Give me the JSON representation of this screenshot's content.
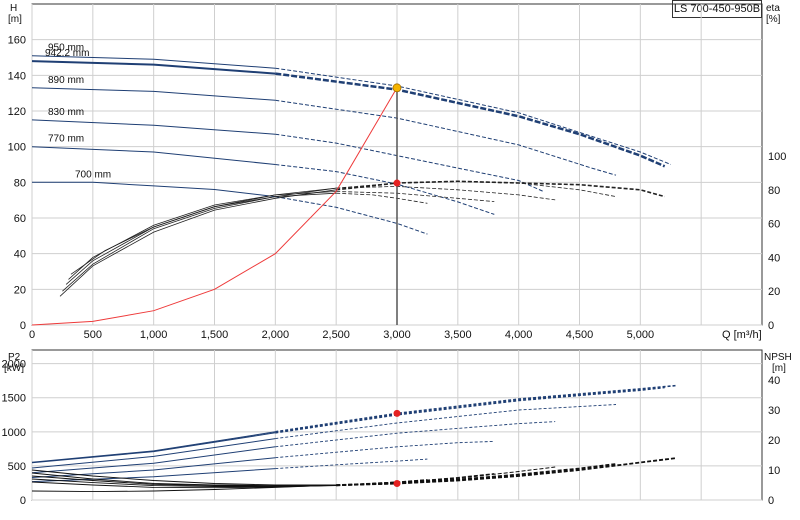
{
  "model_label": "LS 700-450-950B",
  "chart_data": [
    {
      "type": "line",
      "title": "",
      "y_axis_title": "H",
      "y_axis_unit": "[m]",
      "y2_axis_title": "eta",
      "y2_axis_unit": "[%]",
      "x_axis_unit_label": "Q [m³/h]",
      "xlim": [
        0,
        6000
      ],
      "ylim": [
        0,
        180
      ],
      "y2lim": [
        0,
        100
      ],
      "x_ticks": [
        0,
        500,
        1000,
        1500,
        2000,
        2500,
        3000,
        3500,
        4000,
        4500,
        5000
      ],
      "x_tick_labels": [
        "0",
        "500",
        "1,000",
        "1,500",
        "2,000",
        "2,500",
        "3,000",
        "3,500",
        "4,000",
        "4,500",
        "5,000"
      ],
      "y_ticks": [
        0,
        20,
        40,
        60,
        80,
        100,
        120,
        140,
        160
      ],
      "y2_ticks": [
        0,
        20,
        40,
        60,
        80,
        100
      ],
      "grid": true,
      "head_curves": [
        {
          "label": "950 mm",
          "points": [
            [
              0,
              151
            ],
            [
              1000,
              149
            ],
            [
              2000,
              144
            ],
            [
              3000,
              134
            ],
            [
              4000,
              119
            ],
            [
              4500,
              108
            ],
            [
              5000,
              97
            ],
            [
              5250,
              90
            ]
          ]
        },
        {
          "label": "942.2 mm",
          "points": [
            [
              0,
              148
            ],
            [
              1000,
              146
            ],
            [
              2000,
              141
            ],
            [
              3000,
              132
            ],
            [
              4000,
              117
            ],
            [
              4500,
              107
            ],
            [
              5000,
              95
            ],
            [
              5200,
              89
            ]
          ]
        },
        {
          "label": "890 mm",
          "points": [
            [
              0,
              133
            ],
            [
              1000,
              131
            ],
            [
              2000,
              126
            ],
            [
              3000,
              116
            ],
            [
              4000,
              101
            ],
            [
              4600,
              88
            ],
            [
              4800,
              84
            ]
          ]
        },
        {
          "label": "830 mm",
          "points": [
            [
              0,
              115
            ],
            [
              1000,
              112
            ],
            [
              2000,
              107
            ],
            [
              2500,
              102
            ],
            [
              3000,
              95
            ],
            [
              3500,
              88
            ],
            [
              4000,
              81
            ],
            [
              4200,
              75
            ]
          ]
        },
        {
          "label": "770 mm",
          "points": [
            [
              0,
              100
            ],
            [
              1000,
              97
            ],
            [
              2000,
              90
            ],
            [
              2500,
              86
            ],
            [
              3000,
              79
            ],
            [
              3500,
              69
            ],
            [
              3800,
              62
            ]
          ]
        },
        {
          "label": "700 mm",
          "points": [
            [
              0,
              80
            ],
            [
              500,
              80
            ],
            [
              1000,
              78
            ],
            [
              1500,
              76
            ],
            [
              2000,
              72
            ],
            [
              2500,
              66
            ],
            [
              3000,
              57
            ],
            [
              3250,
              51
            ]
          ]
        }
      ],
      "efficiency_curves": [
        {
          "points": [
            [
              230,
              17
            ],
            [
              500,
              35
            ],
            [
              1000,
              55
            ],
            [
              1500,
              68
            ],
            [
              2000,
              75
            ],
            [
              2500,
              80
            ],
            [
              3000,
              84
            ],
            [
              3500,
              85
            ],
            [
              4000,
              84
            ],
            [
              4500,
              83
            ],
            [
              5000,
              80
            ],
            [
              5200,
              76
            ]
          ]
        },
        {
          "points": [
            [
              250,
              20
            ],
            [
              500,
              36
            ],
            [
              1000,
              57
            ],
            [
              1500,
              69
            ],
            [
              2000,
              76
            ],
            [
              2500,
              81
            ],
            [
              3000,
              84
            ],
            [
              3500,
              85
            ],
            [
              4000,
              84
            ],
            [
              4500,
              80
            ],
            [
              4800,
              76
            ]
          ]
        },
        {
          "points": [
            [
              280,
              24
            ],
            [
              500,
              38
            ],
            [
              1000,
              58
            ],
            [
              1500,
              70
            ],
            [
              2000,
              77
            ],
            [
              2500,
              81
            ],
            [
              3000,
              82
            ],
            [
              3500,
              80
            ],
            [
              4000,
              77
            ],
            [
              4300,
              74
            ]
          ]
        },
        {
          "points": [
            [
              300,
              27
            ],
            [
              500,
              40
            ],
            [
              1000,
              59
            ],
            [
              1500,
              71
            ],
            [
              2000,
              77
            ],
            [
              2500,
              79
            ],
            [
              3000,
              78
            ],
            [
              3500,
              75
            ],
            [
              3800,
              73
            ]
          ]
        },
        {
          "points": [
            [
              320,
              30
            ],
            [
              600,
              44
            ],
            [
              1000,
              58
            ],
            [
              1500,
              70
            ],
            [
              2000,
              76
            ],
            [
              2500,
              78
            ],
            [
              2800,
              77
            ],
            [
              3000,
              75
            ],
            [
              3250,
              72
            ]
          ]
        }
      ],
      "system_curve": {
        "points": [
          [
            0,
            0
          ],
          [
            500,
            2
          ],
          [
            1000,
            8
          ],
          [
            1500,
            20
          ],
          [
            2000,
            40
          ],
          [
            2500,
            75
          ],
          [
            3000,
            133
          ]
        ]
      },
      "duty_line_x": 3000,
      "duty_point_head": 133,
      "duty_point_eta": 84
    },
    {
      "type": "line",
      "title": "",
      "y_axis_title": "P2",
      "y_axis_unit": "[kW]",
      "y2_axis_title": "NPSH",
      "y2_axis_unit": "[m]",
      "xlim": [
        0,
        6000
      ],
      "ylim": [
        0,
        2200
      ],
      "y2lim": [
        0,
        50
      ],
      "y_ticks": [
        0,
        500,
        1000,
        1500,
        2000
      ],
      "y2_ticks": [
        0,
        10,
        20,
        30,
        40
      ],
      "grid": true,
      "power_curves": [
        {
          "points": [
            [
              0,
              555
            ],
            [
              1000,
              720
            ],
            [
              2000,
              1000
            ],
            [
              3000,
              1270
            ],
            [
              4000,
              1480
            ],
            [
              5000,
              1630
            ],
            [
              5300,
              1680
            ]
          ]
        },
        {
          "points": [
            [
              0,
              545
            ],
            [
              1000,
              710
            ],
            [
              2000,
              985
            ],
            [
              3000,
              1250
            ],
            [
              4000,
              1460
            ],
            [
              5000,
              1610
            ],
            [
              5200,
              1650
            ]
          ]
        },
        {
          "points": [
            [
              0,
              470
            ],
            [
              1000,
              640
            ],
            [
              2000,
              900
            ],
            [
              3000,
              1130
            ],
            [
              4000,
              1320
            ],
            [
              4800,
              1400
            ]
          ]
        },
        {
          "points": [
            [
              0,
              400
            ],
            [
              1000,
              540
            ],
            [
              2000,
              780
            ],
            [
              3000,
              980
            ],
            [
              4000,
              1120
            ],
            [
              4300,
              1150
            ]
          ]
        },
        {
          "points": [
            [
              0,
              330
            ],
            [
              1000,
              440
            ],
            [
              2000,
              620
            ],
            [
              3000,
              780
            ],
            [
              3500,
              840
            ],
            [
              3800,
              860
            ]
          ]
        },
        {
          "points": [
            [
              0,
              270
            ],
            [
              1000,
              340
            ],
            [
              2000,
              460
            ],
            [
              3000,
              570
            ],
            [
              3250,
              600
            ]
          ]
        }
      ],
      "npsh_curves": [
        {
          "points": [
            [
              0,
              10
            ],
            [
              500,
              8
            ],
            [
              1000,
              6.5
            ],
            [
              1500,
              5.5
            ],
            [
              2000,
              5
            ],
            [
              2500,
              5
            ],
            [
              3000,
              5.5
            ],
            [
              3500,
              6.5
            ],
            [
              4000,
              8
            ],
            [
              4500,
              10
            ],
            [
              5000,
              12.5
            ],
            [
              5300,
              14
            ]
          ]
        },
        {
          "points": [
            [
              0,
              9
            ],
            [
              500,
              7
            ],
            [
              1000,
              5.5
            ],
            [
              1500,
              5
            ],
            [
              2000,
              4.8
            ],
            [
              2500,
              4.9
            ],
            [
              3000,
              5.5
            ],
            [
              3500,
              6.8
            ],
            [
              4000,
              8.5
            ],
            [
              4500,
              10.5
            ],
            [
              4800,
              12
            ]
          ]
        },
        {
          "points": [
            [
              0,
              8
            ],
            [
              500,
              6.5
            ],
            [
              1000,
              5.2
            ],
            [
              1500,
              4.8
            ],
            [
              2000,
              4.6
            ],
            [
              2500,
              4.8
            ],
            [
              3000,
              5.6
            ],
            [
              3500,
              7.2
            ],
            [
              4000,
              9.5
            ],
            [
              4300,
              11
            ]
          ]
        },
        {
          "points": [
            [
              0,
              7
            ],
            [
              500,
              5.8
            ],
            [
              1000,
              4.8
            ],
            [
              1500,
              4.5
            ],
            [
              2000,
              4.5
            ],
            [
              2500,
              4.8
            ],
            [
              3000,
              5.8
            ],
            [
              3500,
              7.5
            ],
            [
              3800,
              8.8
            ]
          ]
        },
        {
          "points": [
            [
              0,
              6
            ],
            [
              500,
              5
            ],
            [
              1000,
              4.2
            ],
            [
              1500,
              4.1
            ],
            [
              2000,
              4.3
            ],
            [
              2500,
              4.9
            ],
            [
              3000,
              6
            ],
            [
              3250,
              6.8
            ]
          ]
        },
        {
          "points": [
            [
              0,
              3
            ],
            [
              500,
              2.8
            ],
            [
              1000,
              3
            ],
            [
              1500,
              3.5
            ],
            [
              2000,
              4.2
            ],
            [
              2500,
              5
            ],
            [
              3000,
              6
            ],
            [
              3250,
              6.6
            ]
          ]
        }
      ],
      "duty_point_power": 1270,
      "duty_point_npsh": 5.5
    }
  ]
}
